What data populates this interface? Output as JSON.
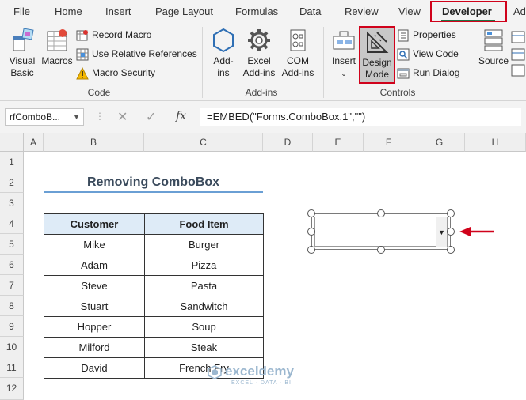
{
  "menu": {
    "tabs": [
      "File",
      "Home",
      "Insert",
      "Page Layout",
      "Formulas",
      "Data",
      "Review",
      "View",
      "Developer",
      "Ad"
    ]
  },
  "ribbon": {
    "code": {
      "label": "Code",
      "visual_basic": "Visual Basic",
      "macros": "Macros",
      "record_macro": "Record Macro",
      "relative_refs": "Use Relative References",
      "macro_security": "Macro Security"
    },
    "addins": {
      "label": "Add-ins",
      "addins": "Add-ins",
      "excel_addins": "Excel Add-ins",
      "com_addins": "COM Add-ins"
    },
    "controls": {
      "label": "Controls",
      "insert": "Insert",
      "design_mode": "Design Mode",
      "properties": "Properties",
      "view_code": "View Code",
      "run_dialog": "Run Dialog"
    },
    "xml": {
      "source": "Source"
    }
  },
  "formula_bar": {
    "name_box": "rfComboB...",
    "formula": "=EMBED(\"Forms.ComboBox.1\",\"\")"
  },
  "columns": [
    "A",
    "B",
    "C",
    "D",
    "E",
    "F",
    "G",
    "H"
  ],
  "rows": [
    "1",
    "2",
    "3",
    "4",
    "5",
    "6",
    "7",
    "8",
    "9",
    "10",
    "11",
    "12"
  ],
  "sheet": {
    "title": "Removing ComboBox",
    "table": {
      "headers": [
        "Customer",
        "Food Item"
      ],
      "rows": [
        [
          "Mike",
          "Burger"
        ],
        [
          "Adam",
          "Pizza"
        ],
        [
          "Steve",
          "Pasta"
        ],
        [
          "Stuart",
          "Sandwitch"
        ],
        [
          "Hopper",
          "Soup"
        ],
        [
          "Milford",
          "Steak"
        ],
        [
          "David",
          "French Fry"
        ]
      ]
    }
  },
  "watermark": {
    "name": "exceldemy",
    "tagline": "EXCEL · DATA · BI"
  },
  "colors": {
    "highlight_red": "#d0021b",
    "excel_green": "#217346",
    "table_header_bg": "#deebf7",
    "title_underline": "#6a9fd4"
  }
}
